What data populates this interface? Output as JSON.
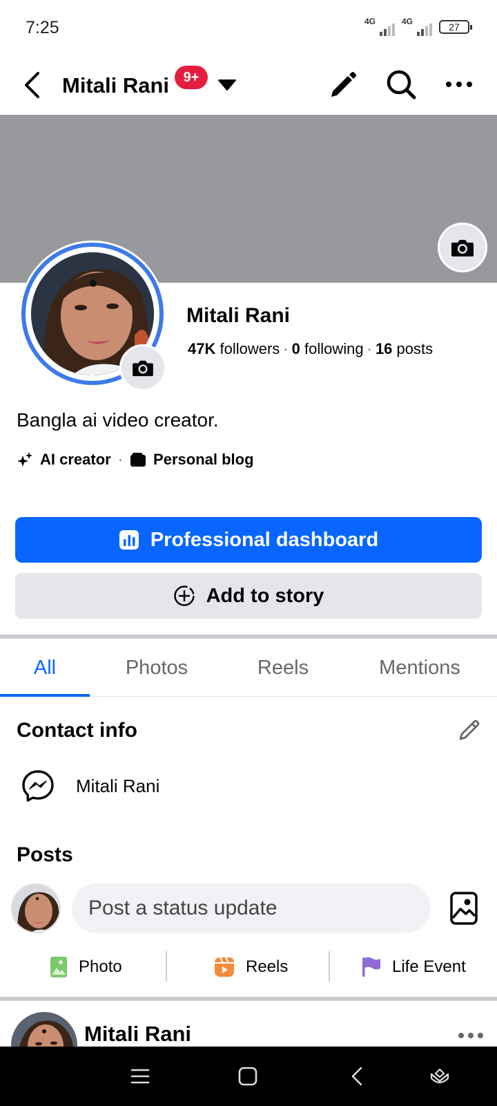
{
  "status_bar": {
    "time": "7:25",
    "network_1": "4G",
    "network_2": "4G",
    "battery": "27"
  },
  "app_bar": {
    "title": "Mitali Rani",
    "notification_badge": "9+"
  },
  "profile": {
    "name": "Mitali Rani",
    "followers_count": "47K",
    "followers_label": "followers",
    "following_count": "0",
    "following_label": "following",
    "posts_count": "16",
    "posts_label": "posts",
    "bio": "Bangla ai video creator.",
    "categories": [
      "AI creator",
      "Personal blog"
    ]
  },
  "actions": {
    "dashboard_label": "Professional dashboard",
    "add_story_label": "Add to story"
  },
  "tabs": [
    {
      "label": "All",
      "active": true
    },
    {
      "label": "Photos",
      "active": false
    },
    {
      "label": "Reels",
      "active": false
    },
    {
      "label": "Mentions",
      "active": false
    }
  ],
  "contact": {
    "title": "Contact info",
    "messenger_name": "Mitali Rani"
  },
  "posts": {
    "title": "Posts",
    "placeholder": "Post a status update",
    "composer_actions": [
      "Photo",
      "Reels",
      "Life Event"
    ]
  },
  "feed": {
    "author": "Mitali Rani"
  },
  "colors": {
    "brand_blue": "#0866ff",
    "badge_red": "#e41e3f",
    "cover_gray": "#97999d"
  }
}
